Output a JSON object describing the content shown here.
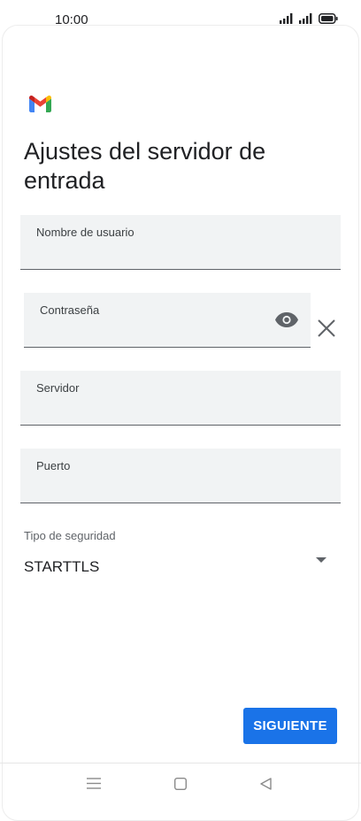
{
  "status_bar": {
    "time": "10:00",
    "icons": [
      "signal-icon",
      "signal-icon",
      "battery-icon"
    ]
  },
  "app": {
    "logo": "gmail-logo"
  },
  "page": {
    "title": "Ajustes del servidor de entrada"
  },
  "form": {
    "username": {
      "label": "Nombre de usuario",
      "value": ""
    },
    "password": {
      "label": "Contraseña",
      "value": "",
      "icons": [
        "eye-icon",
        "close-icon"
      ]
    },
    "server": {
      "label": "Servidor",
      "value": ""
    },
    "port": {
      "label": "Puerto",
      "value": ""
    },
    "security": {
      "label": "Tipo de seguridad",
      "value": "STARTTLS",
      "icon": "dropdown-arrow-icon"
    }
  },
  "actions": {
    "next_label": "SIGUIENTE"
  },
  "nav_bar": {
    "items": [
      "menu-icon",
      "home-icon",
      "back-icon"
    ]
  },
  "colors": {
    "accent": "#1a73e8",
    "field_bg": "#f1f3f4",
    "text": "#202124"
  }
}
